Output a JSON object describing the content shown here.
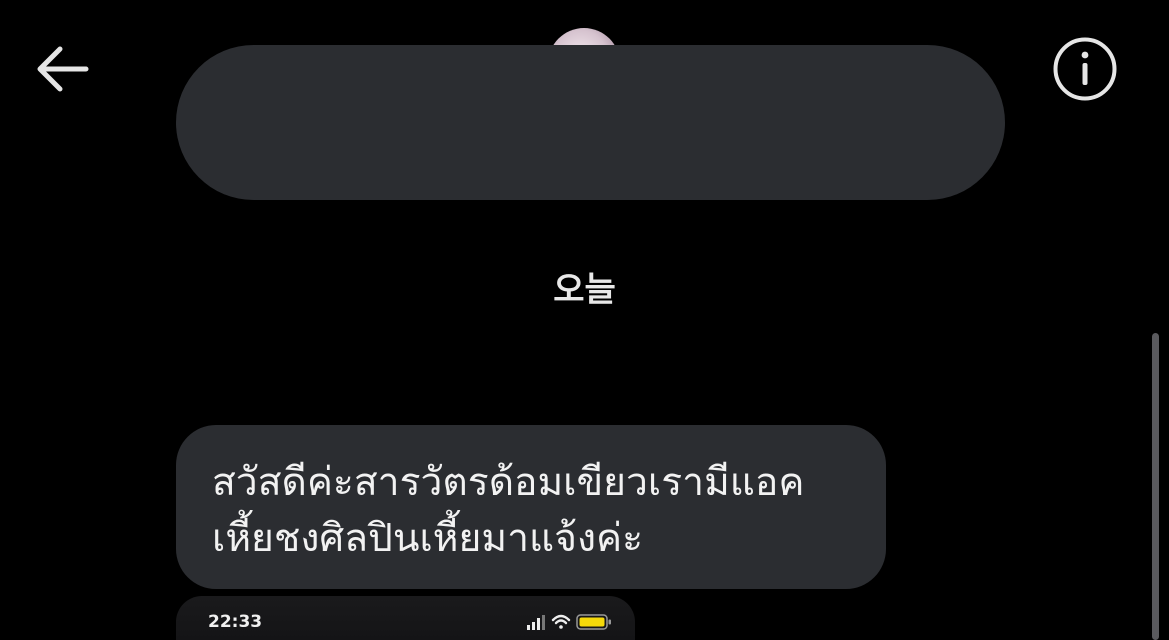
{
  "header": {
    "back_icon": "arrow-left-icon",
    "info_icon": "info-circle-icon"
  },
  "thread": {
    "date_separator": "오늘",
    "message": {
      "line1": "สวัสดีค่ะสารวัตรด้อมเขียวเรามีแอค",
      "line2": "เหี้ยชงศิลปินเหี้ยมาแจ้งค่ะ"
    },
    "attachment": {
      "status_time": "22:33",
      "battery_color": "#f5d90a"
    }
  },
  "colors": {
    "background": "#000000",
    "bubble": "#2b2d31",
    "text": "#f2f2f2"
  }
}
